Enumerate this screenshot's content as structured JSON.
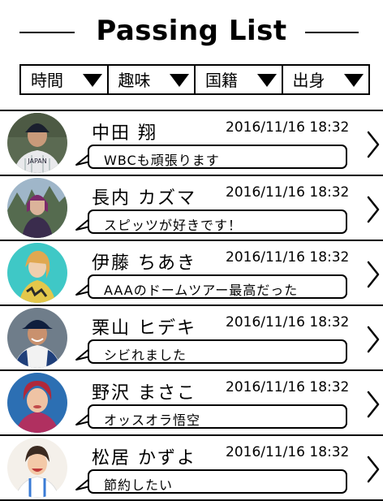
{
  "header": {
    "title": "Passing List"
  },
  "filters": [
    {
      "label": "時間",
      "icon": "triangle-down-icon"
    },
    {
      "label": "趣味",
      "icon": "triangle-down-icon"
    },
    {
      "label": "国籍",
      "icon": "triangle-down-icon"
    },
    {
      "label": "出身",
      "icon": "triangle-down-icon"
    }
  ],
  "people": [
    {
      "name": "中田 翔",
      "time": "2016/11/16 18:32",
      "message": "WBCも頑張ります"
    },
    {
      "name": "長内 カズマ",
      "time": "2016/11/16 18:32",
      "message": "スピッツが好きです！"
    },
    {
      "name": "伊藤 ちあき",
      "time": "2016/11/16 18:32",
      "message": "AAAのドームツアー最高だった"
    },
    {
      "name": "栗山 ヒデキ",
      "time": "2016/11/16 18:32",
      "message": "シビれました"
    },
    {
      "name": "野沢 まさこ",
      "time": "2016/11/16 18:32",
      "message": "オッスオラ悟空"
    },
    {
      "name": "松居 かずよ",
      "time": "2016/11/16 18:32",
      "message": "節約したい"
    }
  ]
}
